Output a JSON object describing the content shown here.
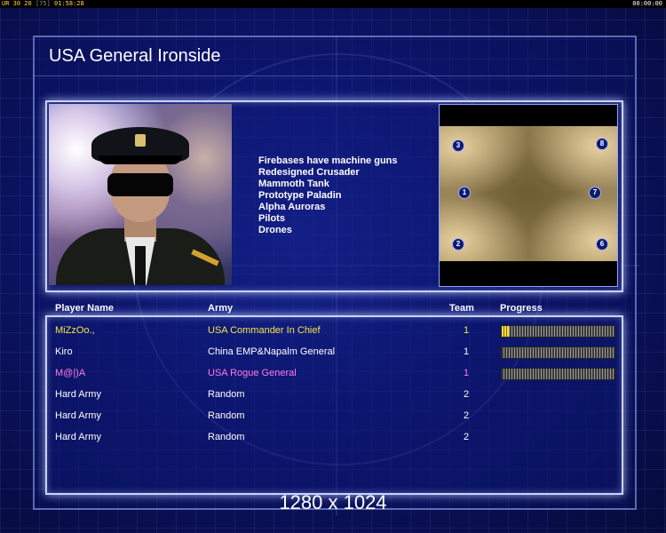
{
  "topbar": {
    "left_a": "UR 30 20",
    "left_b": "[75]",
    "left_c": "01:58:28",
    "right": "00:00:00"
  },
  "title": "USA General Ironside",
  "features": [
    "Firebases have machine guns",
    "Redesigned Crusader",
    "Mammoth Tank",
    "Prototype Paladin",
    "Alpha Auroras",
    "Pilots",
    "Drones"
  ],
  "minimap": {
    "spots": [
      "3",
      "8",
      "1",
      "7",
      "2",
      "6"
    ]
  },
  "table": {
    "headers": {
      "name": "Player Name",
      "army": "Army",
      "team": "Team",
      "progress": "Progress"
    },
    "rows": [
      {
        "name": "MiZzOo.,",
        "army": "USA Commander In Chief",
        "team": "1",
        "color": "#f5e642",
        "team_color": "#f5e642",
        "progress": 0.06
      },
      {
        "name": "Kiro",
        "army": "China EMP&Napalm General",
        "team": "1",
        "color": "#ffffff",
        "team_color": "#ffffff",
        "progress": 0.0
      },
      {
        "name": "M@|)A",
        "army": "USA Rogue General",
        "team": "1",
        "color": "#ff7ae6",
        "team_color": "#ff7ae6",
        "progress": 0.0
      },
      {
        "name": "Hard Army",
        "army": "Random",
        "team": "2",
        "color": "#ffffff",
        "team_color": "#ffffff",
        "progress": null
      },
      {
        "name": "Hard Army",
        "army": "Random",
        "team": "2",
        "color": "#ffffff",
        "team_color": "#ffffff",
        "progress": null
      },
      {
        "name": "Hard Army",
        "army": "Random",
        "team": "2",
        "color": "#ffffff",
        "team_color": "#ffffff",
        "progress": null
      }
    ]
  },
  "resolution": "1280 x 1024"
}
